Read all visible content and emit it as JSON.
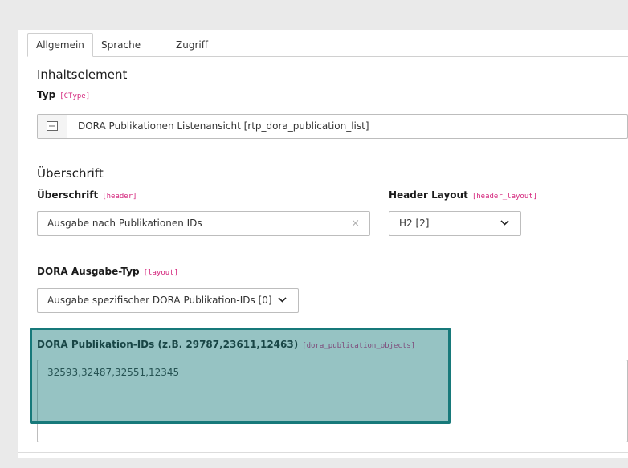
{
  "tabs": [
    {
      "label": "Allgemein",
      "active": true
    },
    {
      "label": "Sprache",
      "active": false
    },
    {
      "label": "Zugriff",
      "active": false
    }
  ],
  "content_element": {
    "section_title": "Inhaltselement",
    "type_label": "Typ",
    "type_code": "[CType]",
    "type_value": "DORA Publikationen Listenansicht [rtp_dora_publication_list]",
    "type_icon": "content-element-icon"
  },
  "header_section": {
    "section_title": "Überschrift",
    "header_label": "Überschrift",
    "header_code": "[header]",
    "header_value": "Ausgabe nach Publikationen IDs",
    "clear_icon": "×",
    "layout_label": "Header Layout",
    "layout_code": "[header_layout]",
    "layout_value": "H2 [2]"
  },
  "output_type": {
    "label": "DORA Ausgabe-Typ",
    "code": "[layout]",
    "value": "Ausgabe spezifischer DORA Publikation-IDs [0]"
  },
  "publication_ids": {
    "label": "DORA Publikation-IDs (z.B. 29787,23611,12463)",
    "code": "[dora_publication_objects]",
    "value": "32593,32487,32551,12345"
  },
  "colors": {
    "accent_code": "#d4257c",
    "highlight": "#17797a"
  }
}
